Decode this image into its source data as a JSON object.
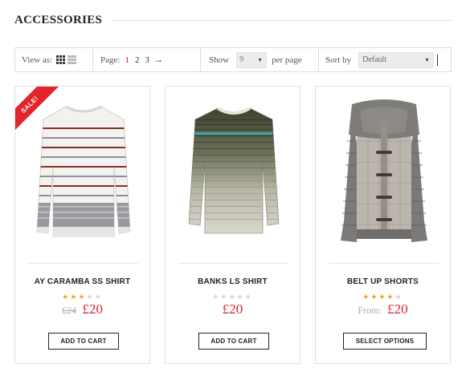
{
  "page": {
    "title": "ACCESSORIES"
  },
  "toolbar": {
    "view_label": "View as:",
    "page_label": "Page:",
    "pages": [
      "1",
      "2",
      "3"
    ],
    "active_page": "1",
    "next_arrow": "→",
    "show_label": "Show",
    "show_value": "9",
    "per_page_label": "per page",
    "sort_label": "Sort by",
    "sort_value": "Default",
    "icons": {
      "grid": "grid-view-icon",
      "list": "list-view-icon",
      "dropdown": "chevron-down-icon"
    }
  },
  "products": [
    {
      "name": "AY CARAMBA SS SHIRT",
      "badge": "SALE!",
      "rating": 3,
      "rating_max": 5,
      "old_price": "£24",
      "price": "£20",
      "button": "ADD TO CART"
    },
    {
      "name": "BANKS LS SHIRT",
      "rating": 0,
      "rating_max": 5,
      "price": "£20",
      "button": "ADD TO CART"
    },
    {
      "name": "BELT UP SHORTS",
      "rating": 4,
      "rating_max": 5,
      "from_label": "From:",
      "price": "£20",
      "button": "SELECT OPTIONS"
    }
  ],
  "colors": {
    "accent": "#d9232d",
    "star": "#f5a623",
    "sale_ribbon": "#e3242b"
  }
}
